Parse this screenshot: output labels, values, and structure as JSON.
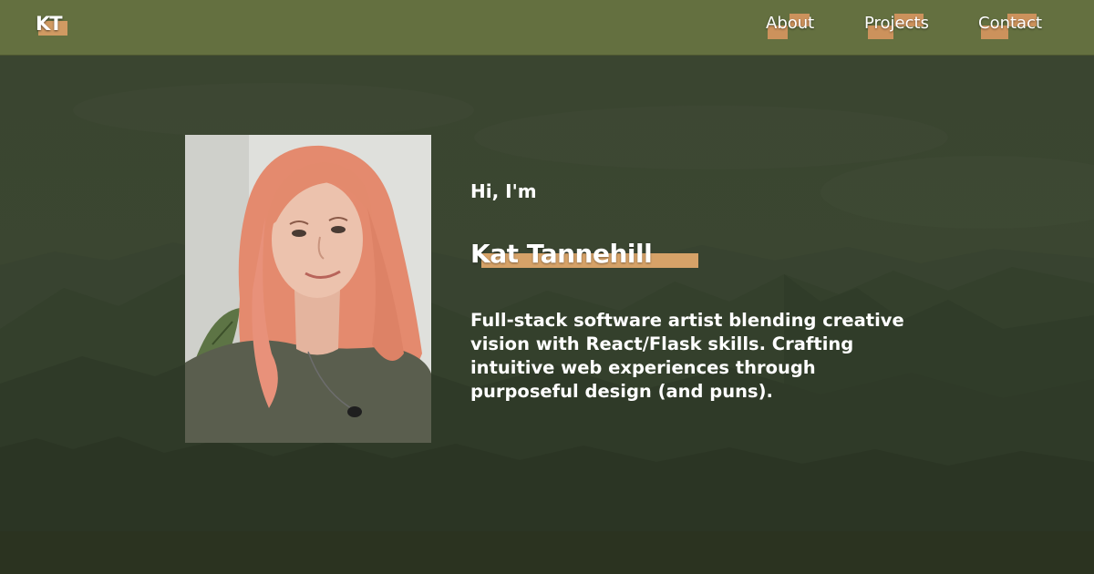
{
  "nav": {
    "logo": "KT",
    "links": [
      {
        "label": "About"
      },
      {
        "label": "Projects"
      },
      {
        "label": "Contact"
      }
    ]
  },
  "hero": {
    "greeting": "Hi, I'm",
    "name": "Kat Tannehill",
    "bio": "Full-stack software artist blending creative vision with React/Flask skills. Crafting intuitive web experiences through purposeful design (and puns).",
    "photo_alt": "Portrait of Kat Tannehill"
  },
  "colors": {
    "navbar": "#647040",
    "accent": "#d6a268",
    "hero_overlay": "#3a4431",
    "footer": "#2b3320",
    "text": "#ffffff"
  }
}
